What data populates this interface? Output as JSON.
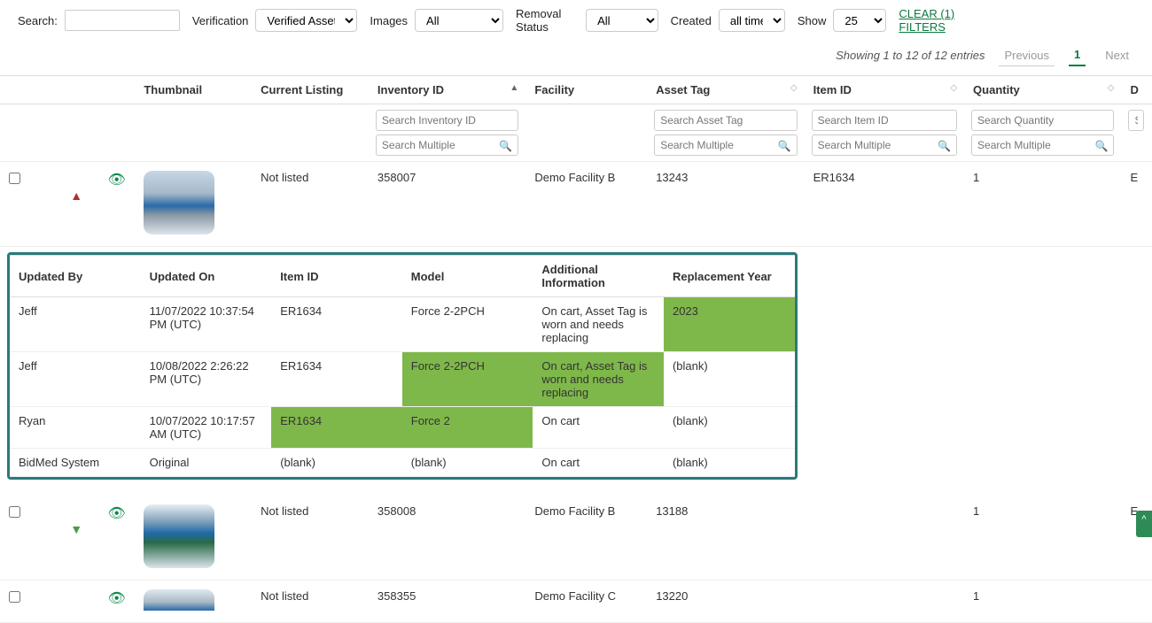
{
  "filters": {
    "search_label": "Search:",
    "verification_label": "Verification",
    "verification_value": "Verified Assets",
    "images_label": "Images",
    "images_value": "All",
    "removal_label": "Removal Status",
    "removal_value": "All",
    "created_label": "Created",
    "created_value": "all time",
    "show_label": "Show",
    "show_value": "25",
    "clear_label": "CLEAR (1) FILTERS"
  },
  "pager": {
    "info": "Showing 1 to 12 of 12 entries",
    "prev": "Previous",
    "page": "1",
    "next": "Next"
  },
  "columns": {
    "thumbnail": "Thumbnail",
    "current_listing": "Current Listing",
    "inventory_id": "Inventory ID",
    "facility": "Facility",
    "asset_tag": "Asset Tag",
    "item_id": "Item ID",
    "quantity": "Quantity",
    "last": "D"
  },
  "search_placeholders": {
    "inventory_id": "Search Inventory ID",
    "asset_tag": "Search Asset Tag",
    "item_id": "Search Item ID",
    "quantity": "Search Quantity",
    "last": "S",
    "multiple": "Search Multiple"
  },
  "rows": [
    {
      "listing": "Not listed",
      "inventory_id": "358007",
      "facility": "Demo Facility B",
      "asset_tag": "13243",
      "item_id": "ER1634",
      "quantity": "1",
      "last": "E"
    },
    {
      "listing": "Not listed",
      "inventory_id": "358008",
      "facility": "Demo Facility B",
      "asset_tag": "13188",
      "item_id": "",
      "quantity": "1",
      "last": "E"
    },
    {
      "listing": "Not listed",
      "inventory_id": "358355",
      "facility": "Demo Facility C",
      "asset_tag": "13220",
      "item_id": "",
      "quantity": "1",
      "last": ""
    }
  ],
  "nested": {
    "headers": {
      "updated_by": "Updated By",
      "updated_on": "Updated On",
      "item_id": "Item ID",
      "model": "Model",
      "additional": "Additional Information",
      "replacement_year": "Replacement Year"
    },
    "rows": [
      {
        "updated_by": "Jeff",
        "updated_on": "11/07/2022 10:37:54 PM (UTC)",
        "item_id": "ER1634",
        "model": "Force 2-2PCH",
        "additional": "On cart, Asset Tag is worn and needs replacing",
        "replacement_year": "2023",
        "hl": [
          "replacement_year"
        ]
      },
      {
        "updated_by": "Jeff",
        "updated_on": "10/08/2022 2:26:22 PM (UTC)",
        "item_id": "ER1634",
        "model": "Force 2-2PCH",
        "additional": "On cart, Asset Tag is worn and needs replacing",
        "replacement_year": "(blank)",
        "hl": [
          "model",
          "additional"
        ]
      },
      {
        "updated_by": "Ryan",
        "updated_on": "10/07/2022 10:17:57 AM (UTC)",
        "item_id": "ER1634",
        "model": "Force 2",
        "additional": "On cart",
        "replacement_year": "(blank)",
        "hl": [
          "item_id",
          "model"
        ]
      },
      {
        "updated_by": "BidMed System",
        "updated_on": "Original",
        "item_id": "(blank)",
        "model": "(blank)",
        "additional": "On cart",
        "replacement_year": "(blank)",
        "hl": []
      }
    ]
  }
}
